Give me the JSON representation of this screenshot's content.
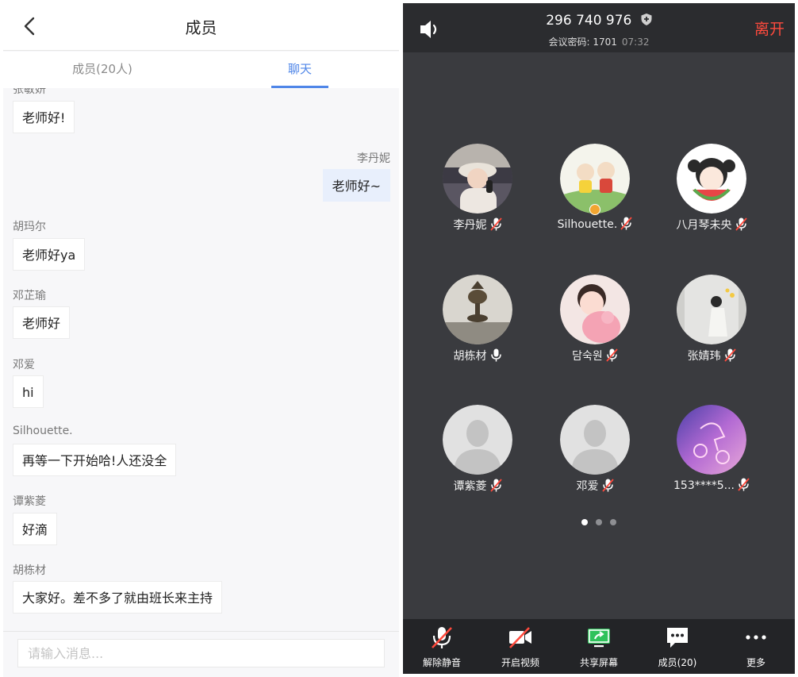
{
  "left": {
    "title": "成员",
    "tabs": [
      {
        "label": "成员(20人)"
      },
      {
        "label": "聊天"
      }
    ],
    "messages": [
      {
        "sender": "张敏妍",
        "text": "老师好!",
        "mine": false
      },
      {
        "sender": "李丹妮",
        "text": "老师好~",
        "mine": true
      },
      {
        "sender": "胡玛尔",
        "text": "老师好ya",
        "mine": false
      },
      {
        "sender": "邓芷瑜",
        "text": "老师好",
        "mine": false
      },
      {
        "sender": "邓爱",
        "text": "hi",
        "mine": false
      },
      {
        "sender": "Silhouette.",
        "text": "再等一下开始哈!人还没全",
        "mine": false
      },
      {
        "sender": "谭紫菱",
        "text": "好滴",
        "mine": false
      },
      {
        "sender": "胡栋材",
        "text": "大家好。差不多了就由班长来主持",
        "mine": false
      }
    ],
    "input_placeholder": "请输入消息..."
  },
  "right": {
    "meeting_id": "296 740 976",
    "password_label": "会议密码: 1701",
    "elapsed": "07:32",
    "leave_label": "离开",
    "participants": [
      {
        "name": "李丹妮",
        "mic": "muted",
        "avatar": "photo-girl-hat"
      },
      {
        "name": "Silhouette.",
        "mic": "muted",
        "avatar": "cartoon-characters",
        "host": true
      },
      {
        "name": "八月琴未央",
        "mic": "muted",
        "avatar": "cartoon-girl-watermelon"
      },
      {
        "name": "胡栋材",
        "mic": "on",
        "avatar": "photo-artifact"
      },
      {
        "name": "담숙원",
        "mic": "muted",
        "avatar": "photo-baby"
      },
      {
        "name": "张婧玮",
        "mic": "muted",
        "avatar": "photo-girl-wall"
      },
      {
        "name": "谭紫菱",
        "mic": "muted",
        "avatar": "default-person"
      },
      {
        "name": "邓爱",
        "mic": "muted",
        "avatar": "default-person"
      },
      {
        "name": "153****5...",
        "mic": "muted",
        "avatar": "neon-horse"
      }
    ],
    "pager": {
      "pages": 3,
      "current": 1
    },
    "toolbar": [
      {
        "label": "解除静音",
        "icon": "mic-muted-icon"
      },
      {
        "label": "开启视频",
        "icon": "video-off-icon"
      },
      {
        "label": "共享屏幕",
        "icon": "share-screen-icon"
      },
      {
        "label": "成员(20)",
        "icon": "chat-members-icon"
      },
      {
        "label": "更多",
        "icon": "more-icon"
      }
    ],
    "colors": {
      "accent": "#4f86e8",
      "leave": "#ff4a3d",
      "share": "#2fc25b",
      "host": "#f2a531"
    }
  }
}
